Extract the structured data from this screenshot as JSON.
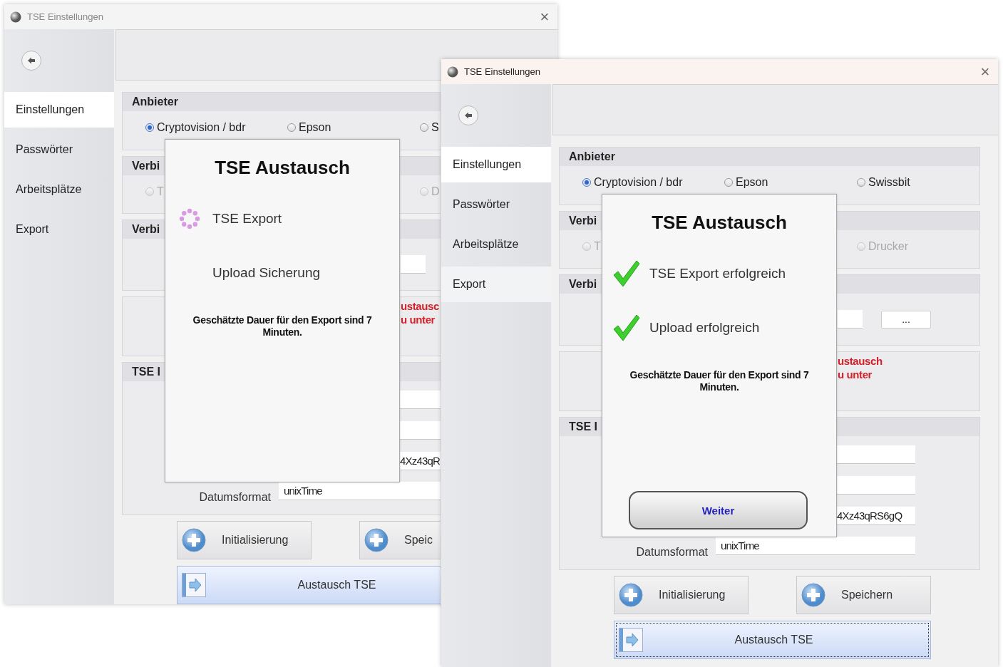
{
  "windows": [
    {
      "title": "TSE Einstellungen",
      "active": false,
      "close": "×",
      "nav": [
        {
          "label": "Einstellungen",
          "selected": true,
          "hovered": false
        },
        {
          "label": "Passwörter",
          "selected": false,
          "hovered": false
        },
        {
          "label": "Arbeitsplätze",
          "selected": false,
          "hovered": false
        },
        {
          "label": "Export",
          "selected": false,
          "hovered": false
        }
      ],
      "provider": {
        "title": "Anbieter",
        "options": [
          {
            "label": "Cryptovision / bdr",
            "selected": true,
            "disabled": false
          },
          {
            "label": "Epson",
            "selected": false,
            "disabled": false
          },
          {
            "label": "S",
            "selected": false,
            "disabled": false
          }
        ]
      },
      "connection": {
        "title": "Verbi",
        "options": [
          {
            "label": "T",
            "selected": false,
            "disabled": true
          },
          {
            "label": "D",
            "selected": false,
            "disabled": true
          }
        ]
      },
      "connection_2": {
        "title": "Verbi"
      },
      "warning": [
        "ustausc",
        "u unter"
      ],
      "tse_info": {
        "title": "TSE I",
        "field_3_value": "4Xz43qR",
        "date_label": "Datumsformat",
        "date_value": "unixTime"
      },
      "buttons": [
        {
          "label": "Initialisierung"
        },
        {
          "label": "Speic"
        }
      ],
      "exchange_button": {
        "label": "Austausch TSE",
        "focused": false
      },
      "dialog": {
        "title": "TSE Austausch",
        "steps": [
          {
            "label": "TSE Export",
            "kind": "loading"
          },
          {
            "label": "Upload Sicherung",
            "kind": "plain"
          }
        ],
        "note": "Geschätzte Dauer für den Export sind 7 Minuten."
      }
    },
    {
      "title": "TSE Einstellungen",
      "active": true,
      "close": "×",
      "nav": [
        {
          "label": "Einstellungen",
          "selected": true,
          "hovered": false
        },
        {
          "label": "Passwörter",
          "selected": false,
          "hovered": false
        },
        {
          "label": "Arbeitsplätze",
          "selected": false,
          "hovered": false
        },
        {
          "label": "Export",
          "selected": false,
          "hovered": true
        }
      ],
      "provider": {
        "title": "Anbieter",
        "options": [
          {
            "label": "Cryptovision / bdr",
            "selected": true,
            "disabled": false
          },
          {
            "label": "Epson",
            "selected": false,
            "disabled": false
          },
          {
            "label": "Swissbit",
            "selected": false,
            "disabled": false
          }
        ]
      },
      "connection": {
        "title": "Verbi",
        "options": [
          {
            "label": "T",
            "selected": false,
            "disabled": true
          },
          {
            "label": "Drucker",
            "selected": false,
            "disabled": true
          }
        ]
      },
      "connection_2": {
        "title": "Verbi",
        "browse_button": "..."
      },
      "warning": [
        "ustausch",
        "u unter"
      ],
      "tse_info": {
        "title": "TSE I",
        "field_3_value": "4Xz43qRS6gQ",
        "date_label": "Datumsformat",
        "date_value": "unixTime"
      },
      "buttons": [
        {
          "label": "Initialisierung"
        },
        {
          "label": "Speichern"
        }
      ],
      "exchange_button": {
        "label": "Austausch TSE",
        "focused": true
      },
      "dialog": {
        "title": "TSE Austausch",
        "steps": [
          {
            "label": "TSE Export erfolgreich",
            "kind": "done"
          },
          {
            "label": "Upload erfolgreich",
            "kind": "done"
          }
        ],
        "note": "Geschätzte Dauer für den Export sind 7 Minuten.",
        "button": "Weiter"
      }
    }
  ]
}
